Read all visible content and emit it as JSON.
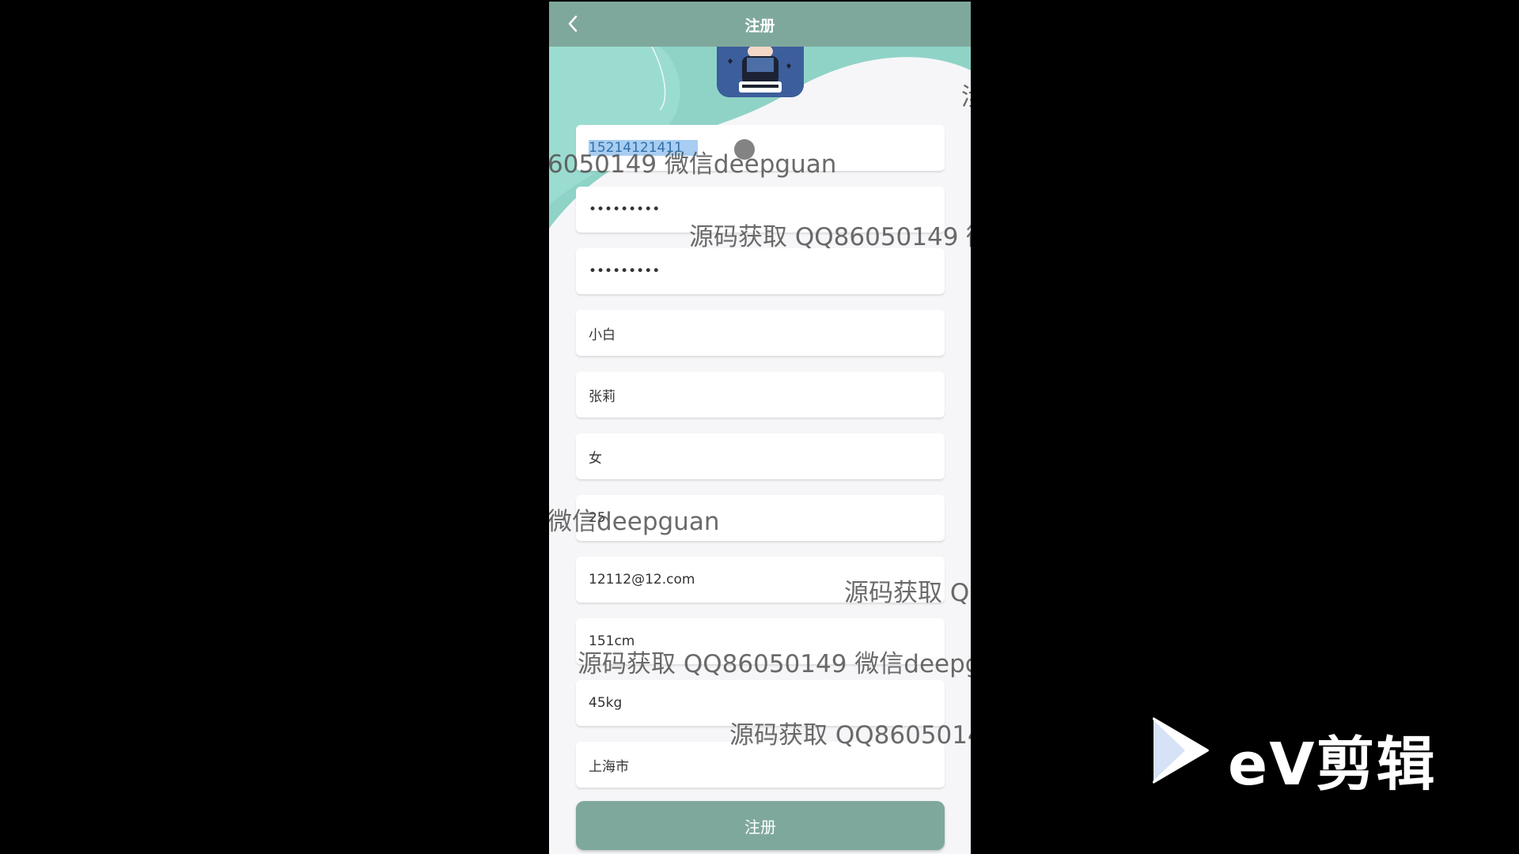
{
  "header": {
    "title": "注册"
  },
  "form": {
    "fields": [
      {
        "value": "15214121411",
        "type": "text"
      },
      {
        "value": "•••••••••",
        "type": "text"
      },
      {
        "value": "•••••••••",
        "type": "text"
      },
      {
        "value": "小白",
        "type": "text"
      },
      {
        "value": "张莉",
        "type": "text"
      },
      {
        "value": "女",
        "type": "text"
      },
      {
        "value": "25",
        "type": "text"
      },
      {
        "value": "12112@12.com",
        "type": "text"
      },
      {
        "value": "151cm",
        "type": "text"
      },
      {
        "value": "45kg",
        "type": "text"
      },
      {
        "value": "上海市",
        "type": "text"
      }
    ],
    "submit_label": "注册"
  },
  "watermarks": [
    "6050149 微信deepguan",
    "源码获取 QQ86050149 微",
    "微信deepguan",
    "源码获取 QC",
    "源码获取 QQ86050149 微信deepgu",
    "源码获取 QQ8605014",
    "涉"
  ],
  "overlay_logo": {
    "text": "eV剪辑"
  },
  "colors": {
    "header": "#7fa89c",
    "accent_teal": "#8fd3c7",
    "submit": "#7fa89c",
    "background": "#f6f6f8"
  },
  "icons": {
    "back": "chevron-left-icon",
    "logo": "play-triangle-icon"
  }
}
